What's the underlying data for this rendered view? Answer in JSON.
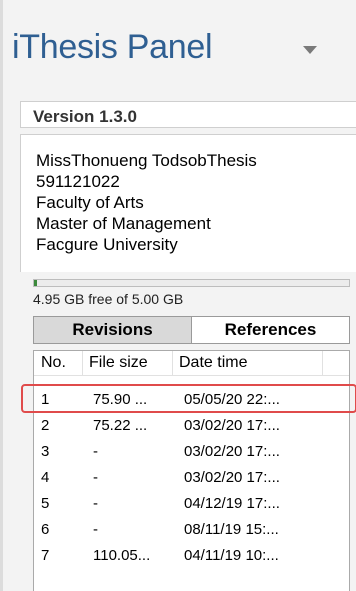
{
  "panel": {
    "title": "iThesis Panel",
    "version": "Version 1.3.0"
  },
  "info": {
    "lines": [
      "MissThonueng TodsobThesis",
      "591121022",
      "Faculty of Arts",
      "Master of Management",
      "Facgure University"
    ]
  },
  "storage": {
    "text": "4.95 GB free of 5.00 GB",
    "used_fraction": 0.01
  },
  "tabs": {
    "revisions": "Revisions",
    "references": "References"
  },
  "table": {
    "headers": {
      "no": "No.",
      "size": "File size",
      "date": "Date time"
    },
    "rows": [
      {
        "no": "1",
        "size": "75.90 ...",
        "date": "05/05/20 22:..."
      },
      {
        "no": "2",
        "size": "75.22 ...",
        "date": "03/02/20 17:..."
      },
      {
        "no": "3",
        "size": "-",
        "date": "03/02/20 17:..."
      },
      {
        "no": "4",
        "size": "-",
        "date": "03/02/20 17:..."
      },
      {
        "no": "5",
        "size": "-",
        "date": "04/12/19 17:..."
      },
      {
        "no": "6",
        "size": "-",
        "date": "08/11/19 15:..."
      },
      {
        "no": "7",
        "size": "110.05...",
        "date": "04/11/19 10:..."
      }
    ]
  },
  "colors": {
    "title": "#2f5f92",
    "highlight": "#e04b4b"
  }
}
